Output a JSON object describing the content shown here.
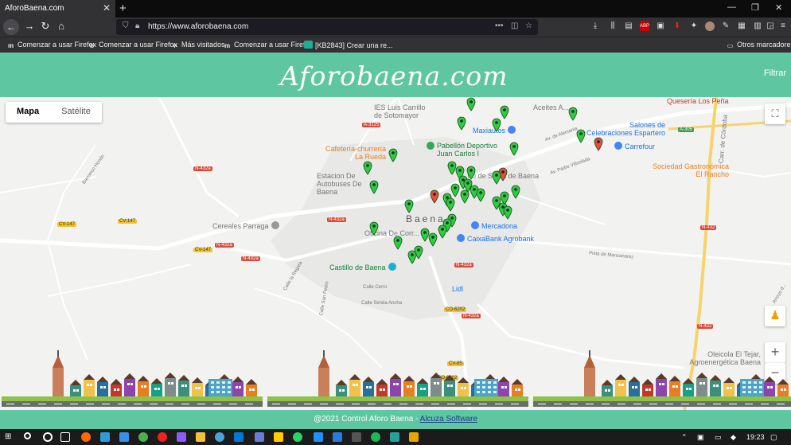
{
  "browser": {
    "tab_title": "AforoBaena.com",
    "url": "https://www.aforobaena.com",
    "bookmarks": [
      {
        "label": "Comenzar a usar Firefox",
        "icon": "m-icon"
      },
      {
        "label": "Comenzar a usar Firefox",
        "icon": "globe-icon"
      },
      {
        "label": "Más visitados",
        "icon": "gear-icon"
      },
      {
        "label": "Comenzar a usar Firefox",
        "icon": "m-icon"
      },
      {
        "label": "[KB2843] Crear una re...",
        "icon": "kb-icon"
      }
    ],
    "other_bookmarks": "Otros marcadores"
  },
  "header": {
    "logo": "Aforobaena.com",
    "filter_label": "Filtrar"
  },
  "map": {
    "type_map": "Mapa",
    "type_satellite": "Satélite",
    "zoom_in": "+",
    "zoom_out": "−",
    "town_label": "Baena",
    "pois": {
      "ies": "IES Luis Carrillo de Sotomayor",
      "aceites": "Aceites A...",
      "queseria": "Quesería Los Peña",
      "maxiautos": "Maxiautos",
      "salones": "Salones de Celebraciones Espartero",
      "cafeteria": "Cafetería-churrería La Rueda",
      "pabellon": "Pabellón Deportivo Juan Carlos I",
      "carrefour": "Carrefour",
      "sociedad": "Sociedad Gastronómica El Rancho",
      "estacion": "Estacion De Autobuses De Baena",
      "salud": "...tro de Salud de Baena",
      "cereales": "Cereales Parraga",
      "oficina": "Oficina De Corr...",
      "mercadona": "Mercadona",
      "caixabank": "CaixaBank Agrobank",
      "castillo": "Castillo de Baena",
      "lidl": "Lidl",
      "oleicola": "Oleicola El Tejar, Agroenergética Baena"
    },
    "road_labels": {
      "a3125": "A-3125",
      "a305": "A-305",
      "n432a_1": "N-432a",
      "n432a_2": "N-432a",
      "n432a_3": "N-432a",
      "n432a_4": "N-432a",
      "n432_1": "N-432",
      "n432_2": "N-432",
      "cv147_1": "CV-147",
      "cv147_2": "CV-147",
      "co6202_1": "CO-6202",
      "co6202_2": "CO-6202",
      "cv85": "CV-85"
    },
    "streets": {
      "arroyo": "Barranco Hondo",
      "av_alemania": "Av. de Alemania",
      "av_padre": "Av. Padre Villoslada",
      "carr_cordoba": "Carr. de Córdoba",
      "pista": "Pista de Manzanarez",
      "calle_laguna": "Calle la Regata",
      "calle_san_pedro": "Calle San Pedro",
      "calle_senda": "Calle Senda Ancha",
      "calle_cerro": "Calle Cerro",
      "arroyo2": "Arroyo d..."
    },
    "markers": [
      {
        "color": "green"
      },
      {
        "color": "green"
      },
      {
        "color": "green"
      },
      {
        "color": "green"
      },
      {
        "color": "red"
      },
      {
        "color": "green"
      },
      {
        "color": "green"
      },
      {
        "color": "green"
      },
      {
        "color": "green"
      },
      {
        "color": "red"
      },
      {
        "color": "green"
      },
      {
        "color": "green"
      },
      {
        "color": "green"
      },
      {
        "color": "green"
      },
      {
        "color": "red"
      },
      {
        "color": "green"
      },
      {
        "color": "green"
      },
      {
        "color": "green"
      },
      {
        "color": "green"
      },
      {
        "color": "green"
      },
      {
        "color": "green"
      },
      {
        "color": "green"
      },
      {
        "color": "green"
      },
      {
        "color": "green"
      },
      {
        "color": "green"
      },
      {
        "color": "green"
      },
      {
        "color": "green"
      },
      {
        "color": "green"
      },
      {
        "color": "green"
      },
      {
        "color": "green"
      },
      {
        "color": "green"
      },
      {
        "color": "green"
      },
      {
        "color": "green"
      },
      {
        "color": "green"
      },
      {
        "color": "green"
      },
      {
        "color": "green"
      },
      {
        "color": "green"
      },
      {
        "color": "green"
      },
      {
        "color": "green"
      },
      {
        "color": "green"
      }
    ]
  },
  "footer": {
    "text": "@2021 Control Aforo Baena - ",
    "link": "Alcuza Software"
  },
  "taskbar": {
    "time": "19:23"
  },
  "colors": {
    "brand": "#5fc6a2",
    "marker_green": "#2ecc40",
    "marker_red": "#e74c3c"
  }
}
